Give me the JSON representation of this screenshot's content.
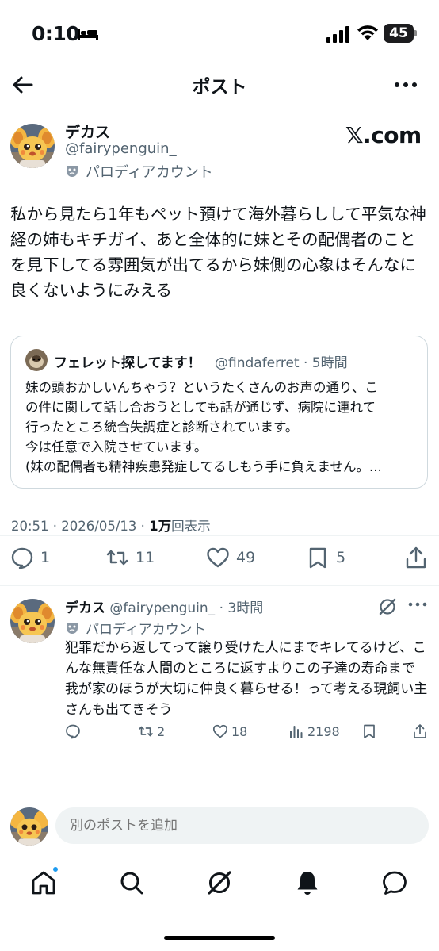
{
  "status_bar": {
    "time": "0:10",
    "battery": "45"
  },
  "header": {
    "title": "ポスト"
  },
  "post": {
    "author_name": "デカス",
    "author_handle": "@fairypenguin_",
    "parody_label": "パロディアカウント",
    "brand": "𝕏.com",
    "body": "私から見たら1年もペット預けて海外暮らしして平気な神経の姉もキチガイ、あと全体的に妹とその配偶者のことを見下してる雰囲気が出てるから妹側の心象はそんなに良くないようにみえる",
    "quote": {
      "author_name": "フェレット探してます！",
      "author_handle": "@findaferret · 5時間",
      "lines": [
        "妹の頭おかしいんちゃう？というたくさんのお声の通り、こ",
        "の件に関して話し合おうとしても話が通じず、病院に連れて",
        "行ったところ統合失調症と診断されています。",
        "今は任意で入院させています。",
        "(妹の配偶者も精神疾患発症してるしもう手に負えません。..."
      ]
    },
    "timestamp_prefix": "20:51 · 2026/05/13 · ",
    "views_count": "1万",
    "views_label": "回表示",
    "stats": {
      "replies": "1",
      "reposts": "11",
      "likes": "49",
      "bookmarks": "5"
    }
  },
  "reply": {
    "author_name": "デカス",
    "meta": " @fairypenguin_ · 3時間",
    "parody_label": "パロディアカウント",
    "body": "犯罪だから返してって譲り受けた人にまでキレてるけど、こんな無責任な人間のところに返すよりこの子達の寿命まで我が家のほうが大切に仲良く暮らせる！って考える現飼い主さんも出てきそう",
    "stats": {
      "replies": "",
      "reposts": "2",
      "likes": "18",
      "views": "2198"
    }
  },
  "compose": {
    "placeholder": "別のポストを追加"
  },
  "colors": {
    "accent": "#1d9bf0",
    "text": "#0f1419",
    "secondary": "#536471",
    "border": "#cfd9de"
  },
  "nav": {
    "items": [
      "home-icon",
      "search-icon",
      "grok-icon",
      "bell-icon",
      "message-icon"
    ]
  }
}
